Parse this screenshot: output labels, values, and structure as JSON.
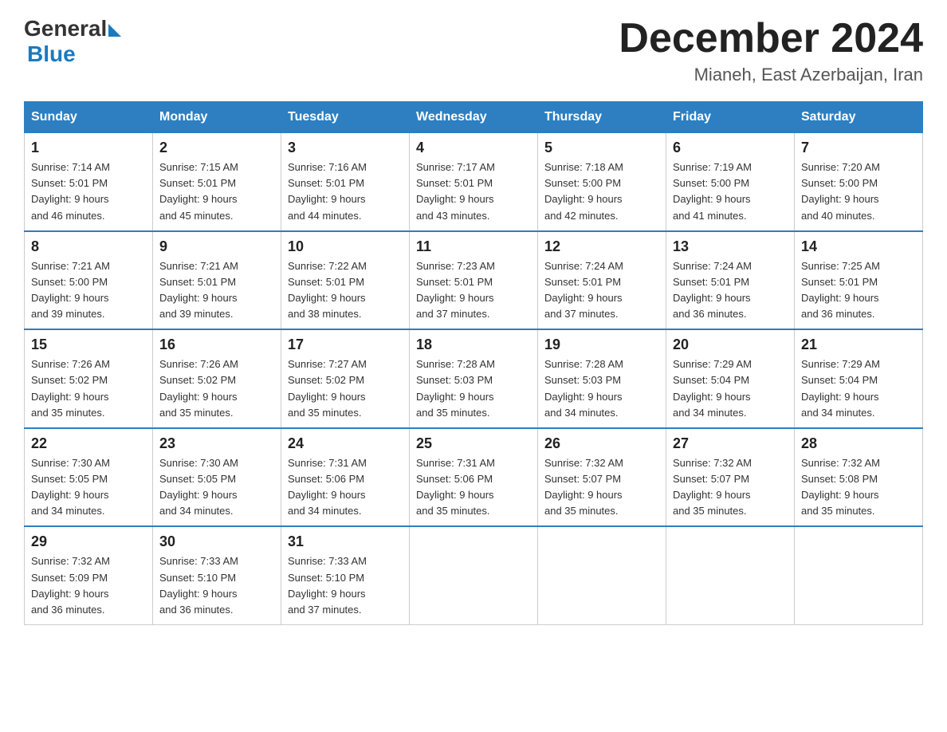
{
  "header": {
    "logo": {
      "general": "General",
      "blue": "Blue"
    },
    "title": "December 2024",
    "location": "Mianeh, East Azerbaijan, Iran"
  },
  "calendar": {
    "days_of_week": [
      "Sunday",
      "Monday",
      "Tuesday",
      "Wednesday",
      "Thursday",
      "Friday",
      "Saturday"
    ],
    "weeks": [
      [
        {
          "day": "1",
          "sunrise": "7:14 AM",
          "sunset": "5:01 PM",
          "daylight": "9 hours and 46 minutes."
        },
        {
          "day": "2",
          "sunrise": "7:15 AM",
          "sunset": "5:01 PM",
          "daylight": "9 hours and 45 minutes."
        },
        {
          "day": "3",
          "sunrise": "7:16 AM",
          "sunset": "5:01 PM",
          "daylight": "9 hours and 44 minutes."
        },
        {
          "day": "4",
          "sunrise": "7:17 AM",
          "sunset": "5:01 PM",
          "daylight": "9 hours and 43 minutes."
        },
        {
          "day": "5",
          "sunrise": "7:18 AM",
          "sunset": "5:00 PM",
          "daylight": "9 hours and 42 minutes."
        },
        {
          "day": "6",
          "sunrise": "7:19 AM",
          "sunset": "5:00 PM",
          "daylight": "9 hours and 41 minutes."
        },
        {
          "day": "7",
          "sunrise": "7:20 AM",
          "sunset": "5:00 PM",
          "daylight": "9 hours and 40 minutes."
        }
      ],
      [
        {
          "day": "8",
          "sunrise": "7:21 AM",
          "sunset": "5:00 PM",
          "daylight": "9 hours and 39 minutes."
        },
        {
          "day": "9",
          "sunrise": "7:21 AM",
          "sunset": "5:01 PM",
          "daylight": "9 hours and 39 minutes."
        },
        {
          "day": "10",
          "sunrise": "7:22 AM",
          "sunset": "5:01 PM",
          "daylight": "9 hours and 38 minutes."
        },
        {
          "day": "11",
          "sunrise": "7:23 AM",
          "sunset": "5:01 PM",
          "daylight": "9 hours and 37 minutes."
        },
        {
          "day": "12",
          "sunrise": "7:24 AM",
          "sunset": "5:01 PM",
          "daylight": "9 hours and 37 minutes."
        },
        {
          "day": "13",
          "sunrise": "7:24 AM",
          "sunset": "5:01 PM",
          "daylight": "9 hours and 36 minutes."
        },
        {
          "day": "14",
          "sunrise": "7:25 AM",
          "sunset": "5:01 PM",
          "daylight": "9 hours and 36 minutes."
        }
      ],
      [
        {
          "day": "15",
          "sunrise": "7:26 AM",
          "sunset": "5:02 PM",
          "daylight": "9 hours and 35 minutes."
        },
        {
          "day": "16",
          "sunrise": "7:26 AM",
          "sunset": "5:02 PM",
          "daylight": "9 hours and 35 minutes."
        },
        {
          "day": "17",
          "sunrise": "7:27 AM",
          "sunset": "5:02 PM",
          "daylight": "9 hours and 35 minutes."
        },
        {
          "day": "18",
          "sunrise": "7:28 AM",
          "sunset": "5:03 PM",
          "daylight": "9 hours and 35 minutes."
        },
        {
          "day": "19",
          "sunrise": "7:28 AM",
          "sunset": "5:03 PM",
          "daylight": "9 hours and 34 minutes."
        },
        {
          "day": "20",
          "sunrise": "7:29 AM",
          "sunset": "5:04 PM",
          "daylight": "9 hours and 34 minutes."
        },
        {
          "day": "21",
          "sunrise": "7:29 AM",
          "sunset": "5:04 PM",
          "daylight": "9 hours and 34 minutes."
        }
      ],
      [
        {
          "day": "22",
          "sunrise": "7:30 AM",
          "sunset": "5:05 PM",
          "daylight": "9 hours and 34 minutes."
        },
        {
          "day": "23",
          "sunrise": "7:30 AM",
          "sunset": "5:05 PM",
          "daylight": "9 hours and 34 minutes."
        },
        {
          "day": "24",
          "sunrise": "7:31 AM",
          "sunset": "5:06 PM",
          "daylight": "9 hours and 34 minutes."
        },
        {
          "day": "25",
          "sunrise": "7:31 AM",
          "sunset": "5:06 PM",
          "daylight": "9 hours and 35 minutes."
        },
        {
          "day": "26",
          "sunrise": "7:32 AM",
          "sunset": "5:07 PM",
          "daylight": "9 hours and 35 minutes."
        },
        {
          "day": "27",
          "sunrise": "7:32 AM",
          "sunset": "5:07 PM",
          "daylight": "9 hours and 35 minutes."
        },
        {
          "day": "28",
          "sunrise": "7:32 AM",
          "sunset": "5:08 PM",
          "daylight": "9 hours and 35 minutes."
        }
      ],
      [
        {
          "day": "29",
          "sunrise": "7:32 AM",
          "sunset": "5:09 PM",
          "daylight": "9 hours and 36 minutes."
        },
        {
          "day": "30",
          "sunrise": "7:33 AM",
          "sunset": "5:10 PM",
          "daylight": "9 hours and 36 minutes."
        },
        {
          "day": "31",
          "sunrise": "7:33 AM",
          "sunset": "5:10 PM",
          "daylight": "9 hours and 37 minutes."
        },
        null,
        null,
        null,
        null
      ]
    ]
  }
}
